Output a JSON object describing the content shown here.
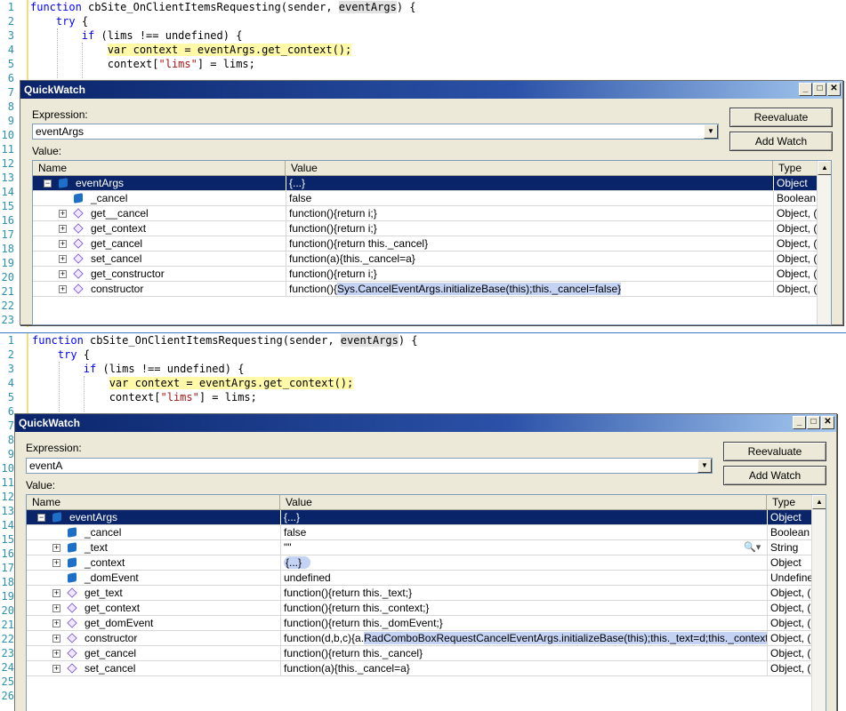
{
  "code": {
    "line_numbers": [
      "1",
      "2",
      "3",
      "4",
      "5",
      "6",
      "7",
      "8",
      "9",
      "10",
      "11",
      "12",
      "13",
      "14",
      "15",
      "16",
      "17",
      "18",
      "19",
      "20",
      "21",
      "22",
      "23",
      "24",
      "25",
      "26"
    ],
    "line1": {
      "kw": "function",
      "name": " cbSite_OnClientItemsRequesting(sender, ",
      "arg": "eventArgs",
      "end": ") {"
    },
    "line2": {
      "kw": "try",
      "rest": " {"
    },
    "line3": {
      "kw": "if",
      "rest": " (lims !== undefined) {"
    },
    "line4": {
      "text": "var context = eventArgs.get_context();"
    },
    "line5": {
      "a": "context[",
      "s": "\"lims\"",
      "b": "] = lims;"
    }
  },
  "quickwatch1": {
    "title": "QuickWatch",
    "expression_label": "Expression:",
    "expression_value": "eventArgs",
    "value_label": "Value:",
    "reevaluate": "Reevaluate",
    "add_watch": "Add Watch",
    "columns": [
      "Name",
      "Value",
      "Type"
    ],
    "rows": [
      {
        "name": "eventArgs",
        "value": "{...}",
        "type": "Object"
      },
      {
        "name": "_cancel",
        "value": "false",
        "type": "Boolean"
      },
      {
        "name": "get__cancel",
        "value": "function(){return i;}",
        "type": "Object, ("
      },
      {
        "name": "get_context",
        "value": "function(){return i;}",
        "type": "Object, ("
      },
      {
        "name": "get_cancel",
        "value": "function(){return this._cancel}",
        "type": "Object, ("
      },
      {
        "name": "set_cancel",
        "value": "function(a){this._cancel=a}",
        "type": "Object, ("
      },
      {
        "name": "get_constructor",
        "value": "function(){return i;}",
        "type": "Object, ("
      },
      {
        "name": "constructor",
        "value_a": "function(){",
        "value_b": "Sys.CancelEventArgs.initializeBase(this);this._cancel=false}",
        "type": "Object, ("
      }
    ]
  },
  "quickwatch2": {
    "title": "QuickWatch",
    "expression_label": "Expression:",
    "expression_value": "eventA",
    "value_label": "Value:",
    "reevaluate": "Reevaluate",
    "add_watch": "Add Watch",
    "columns": [
      "Name",
      "Value",
      "Type"
    ],
    "rows": [
      {
        "name": "eventArgs",
        "value": "{...}",
        "type": "Object"
      },
      {
        "name": "_cancel",
        "value": "false",
        "type": "Boolean"
      },
      {
        "name": "_text",
        "value": "\"\"",
        "type": "String"
      },
      {
        "name": "_context",
        "value": "{...}",
        "type": "Object"
      },
      {
        "name": "_domEvent",
        "value": "undefined",
        "type": "Undefine"
      },
      {
        "name": "get_text",
        "value": "function(){return this._text;}",
        "type": "Object, ("
      },
      {
        "name": "get_context",
        "value": "function(){return this._context;}",
        "type": "Object, ("
      },
      {
        "name": "get_domEvent",
        "value": "function(){return this._domEvent;}",
        "type": "Object, ("
      },
      {
        "name": "constructor",
        "value_a": "function(d,b,c){a.",
        "value_b": "RadComboBoxRequestCancelEventArgs.initializeBase(this);this._text=d;this._context=b",
        "type": "Object, ("
      },
      {
        "name": "get_cancel",
        "value": "function(){return this._cancel}",
        "type": "Object, ("
      },
      {
        "name": "set_cancel",
        "value": "function(a){this._cancel=a}",
        "type": "Object, ("
      }
    ]
  }
}
